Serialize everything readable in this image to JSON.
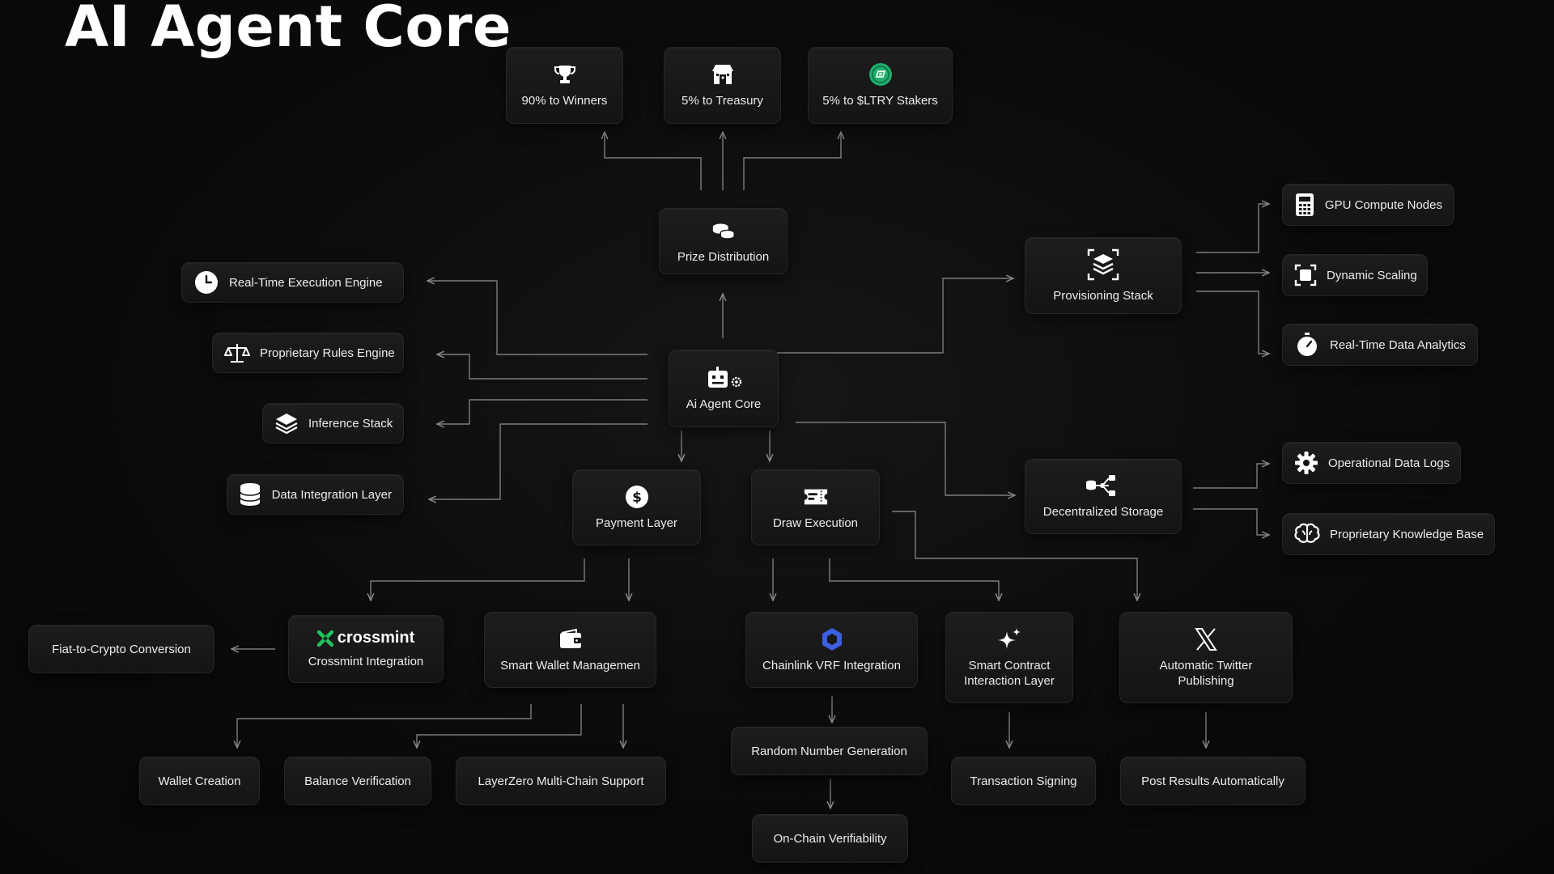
{
  "title": "AI Agent Core",
  "distribution": [
    {
      "label": "90% to Winners",
      "icon": "trophy-icon"
    },
    {
      "label": "5% to Treasury",
      "icon": "treasury-icon"
    },
    {
      "label": "5% to $LTRY Stakers",
      "icon": "ltry-token-icon"
    }
  ],
  "prize_distribution": {
    "label": "Prize Distribution",
    "icon": "coins-icon"
  },
  "core": {
    "label": "Ai Agent Core",
    "icon": "robot-gear-icon"
  },
  "left_modules": [
    {
      "label": "Real-Time Execution Engine",
      "icon": "clock-icon"
    },
    {
      "label": "Proprietary Rules Engine",
      "icon": "scales-icon"
    },
    {
      "label": "Inference Stack",
      "icon": "layers-icon"
    },
    {
      "label": "Data Integration Layer",
      "icon": "database-icon"
    }
  ],
  "provisioning": {
    "label": "Provisioning Stack",
    "icon": "stack-icon"
  },
  "provisioning_children": [
    {
      "label": "GPU Compute Nodes",
      "icon": "calculator-icon"
    },
    {
      "label": "Dynamic Scaling",
      "icon": "scaling-icon"
    },
    {
      "label": "Real-Time Data Analytics",
      "icon": "stopwatch-icon"
    }
  ],
  "storage": {
    "label": "Decentralized Storage",
    "icon": "storage-network-icon"
  },
  "storage_children": [
    {
      "label": "Operational Data Logs",
      "icon": "gear-icon"
    },
    {
      "label": "Proprietary Knowledge Base",
      "icon": "brain-icon"
    }
  ],
  "payment": {
    "label": "Payment Layer",
    "icon": "dollar-icon"
  },
  "draw": {
    "label": "Draw Execution",
    "icon": "ticket-icon"
  },
  "crossmint": {
    "brand": "crossmint",
    "label": "Crossmint Integration"
  },
  "fiat": {
    "label": "Fiat-to-Crypto Conversion"
  },
  "smart_wallet": {
    "label": "Smart Wallet Managemen",
    "icon": "wallet-icon"
  },
  "wallet_children": [
    "Wallet Creation",
    "Balance Verification",
    "LayerZero Multi-Chain Support"
  ],
  "chainlink": {
    "label": "Chainlink VRF Integration",
    "icon": "chainlink-icon",
    "color": "#3b5fe0"
  },
  "random_number": "Random Number Generation",
  "onchain": "On-Chain Verifiability",
  "smart_contract": {
    "label": "Smart Contract Interaction Layer",
    "icon": "sparkle-icon"
  },
  "tx_signing": "Transaction Signing",
  "twitter": {
    "label": "Automatic Twitter Publishing",
    "icon": "x-logo-icon"
  },
  "post_results": "Post Results Automatically",
  "colors": {
    "background": "#0b0b0b",
    "node": "#171717",
    "line": "#8a8a8a",
    "ltry_token": "#1fae6b",
    "crossmint_green": "#22c55e"
  }
}
